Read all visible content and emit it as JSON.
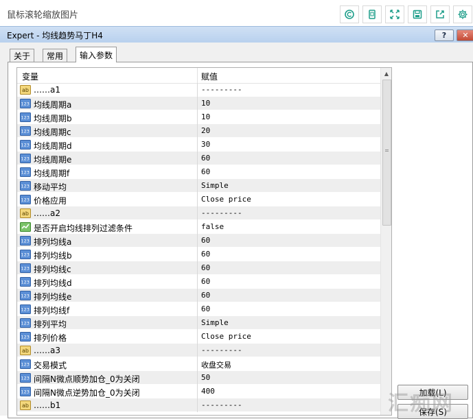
{
  "viewer": {
    "title": "鼠标滚轮缩放图片",
    "accent": "#1e9e8a"
  },
  "dialog": {
    "title": "Expert - 均线趋势马丁H4",
    "help_label": "?",
    "close_label": "✕"
  },
  "tabs": [
    {
      "label": "关于",
      "active": false
    },
    {
      "label": "常用",
      "active": false
    },
    {
      "label": "输入参数",
      "active": true
    }
  ],
  "grid": {
    "col_variable": "变量",
    "col_value": "赋值",
    "rows": [
      {
        "icon": "ab",
        "name": "……a1",
        "value": "---------"
      },
      {
        "icon": "123",
        "name": "均线周期a",
        "value": "10"
      },
      {
        "icon": "123",
        "name": "均线周期b",
        "value": "10"
      },
      {
        "icon": "123",
        "name": "均线周期c",
        "value": "20"
      },
      {
        "icon": "123",
        "name": "均线周期d",
        "value": "30"
      },
      {
        "icon": "123",
        "name": "均线周期e",
        "value": "60"
      },
      {
        "icon": "123",
        "name": "均线周期f",
        "value": "60"
      },
      {
        "icon": "123",
        "name": "移动平均",
        "value": "Simple"
      },
      {
        "icon": "123",
        "name": "价格应用",
        "value": "Close price"
      },
      {
        "icon": "ab",
        "name": "……a2",
        "value": "---------"
      },
      {
        "icon": "bool",
        "name": "是否开启均线排列过滤条件",
        "value": "false"
      },
      {
        "icon": "123",
        "name": "排列均线a",
        "value": "60"
      },
      {
        "icon": "123",
        "name": "排列均线b",
        "value": "60"
      },
      {
        "icon": "123",
        "name": "排列均线c",
        "value": "60"
      },
      {
        "icon": "123",
        "name": "排列均线d",
        "value": "60"
      },
      {
        "icon": "123",
        "name": "排列均线e",
        "value": "60"
      },
      {
        "icon": "123",
        "name": "排列均线f",
        "value": "60"
      },
      {
        "icon": "123",
        "name": "排列平均",
        "value": "Simple"
      },
      {
        "icon": "123",
        "name": "排列价格",
        "value": "Close price"
      },
      {
        "icon": "ab",
        "name": "……a3",
        "value": "---------"
      },
      {
        "icon": "123",
        "name": "交易模式",
        "value": "收盘交易"
      },
      {
        "icon": "123",
        "name": "间隔N微点顺势加仓_0为关闭",
        "value": "50"
      },
      {
        "icon": "123",
        "name": "间隔N微点逆势加仓_0为关闭",
        "value": "400"
      },
      {
        "icon": "ab",
        "name": "……b1",
        "value": "---------"
      }
    ]
  },
  "buttons": {
    "load": "加载(L)",
    "save": "保存(S)"
  },
  "watermark": "汇痴网"
}
